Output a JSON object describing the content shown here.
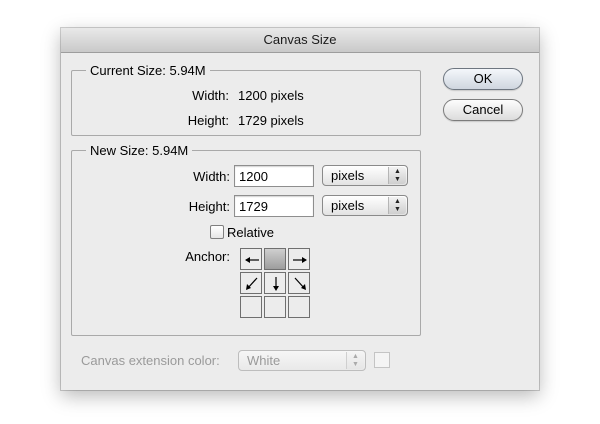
{
  "dialog": {
    "title": "Canvas Size",
    "ok_label": "OK",
    "cancel_label": "Cancel"
  },
  "current_size": {
    "legend": "Current Size: 5.94M",
    "width_label": "Width:",
    "width_value": "1200 pixels",
    "height_label": "Height:",
    "height_value": "1729 pixels"
  },
  "new_size": {
    "legend": "New Size: 5.94M",
    "width_label": "Width:",
    "width_value": "1200",
    "width_unit": "pixels",
    "height_label": "Height:",
    "height_value": "1729",
    "height_unit": "pixels",
    "relative_label": "Relative",
    "relative_checked": false,
    "anchor_label": "Anchor:",
    "anchor_selected": "top-center"
  },
  "extension": {
    "label": "Canvas extension color:",
    "value": "White",
    "enabled": false
  },
  "icons": {
    "popup_arrows": "up-down-arrows-icon",
    "anchor_arrows": [
      "arrow-left-icon",
      "arrow-right-icon",
      "arrow-down-left-icon",
      "arrow-down-icon",
      "arrow-down-right-icon"
    ]
  }
}
